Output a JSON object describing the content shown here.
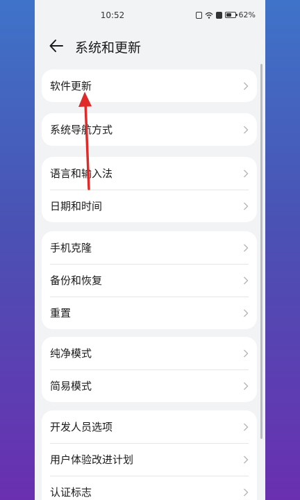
{
  "status_bar": {
    "time": "10:52",
    "battery": "62%"
  },
  "header": {
    "title": "系统和更新"
  },
  "groups": [
    {
      "items": [
        {
          "label": "软件更新"
        }
      ]
    },
    {
      "items": [
        {
          "label": "系统导航方式"
        }
      ]
    },
    {
      "items": [
        {
          "label": "语言和输入法"
        },
        {
          "label": "日期和时间"
        }
      ]
    },
    {
      "items": [
        {
          "label": "手机克隆"
        },
        {
          "label": "备份和恢复"
        },
        {
          "label": "重置"
        }
      ]
    },
    {
      "items": [
        {
          "label": "纯净模式"
        },
        {
          "label": "简易模式"
        }
      ]
    },
    {
      "items": [
        {
          "label": "开发人员选项"
        },
        {
          "label": "用户体验改进计划"
        },
        {
          "label": "认证标志"
        }
      ]
    }
  ],
  "colors": {
    "annotation_arrow": "#e02a2a",
    "card_bg": "#ffffff",
    "page_bg": "#f1f3f5"
  },
  "icons": [
    "back-arrow-icon",
    "chevron-right-icon",
    "nfc-icon",
    "wifi-icon",
    "battery-icon"
  ]
}
